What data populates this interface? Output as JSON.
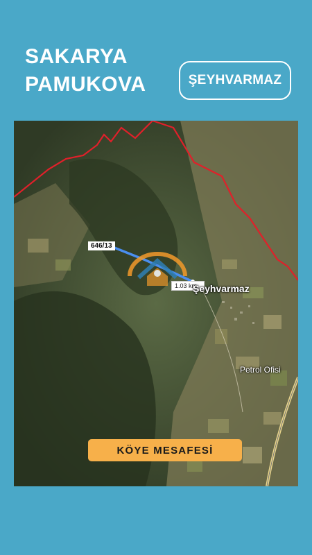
{
  "header": {
    "city": "SAKARYA",
    "district": "PAMUKOVA"
  },
  "village_badge": "ŞEYHVARMAZ",
  "map": {
    "parcel_label": "646/13",
    "distance_label": "1.03 km",
    "places": [
      "Şeyhvarmaz",
      "Petrol Ofisi"
    ],
    "boundary_color": "#e0202a",
    "route_color": "#4a8ef0"
  },
  "cta_label": "KÖYE MESAFESİ",
  "colors": {
    "background": "#4aa8c8",
    "cta": "#f7b04a",
    "text": "#ffffff"
  }
}
